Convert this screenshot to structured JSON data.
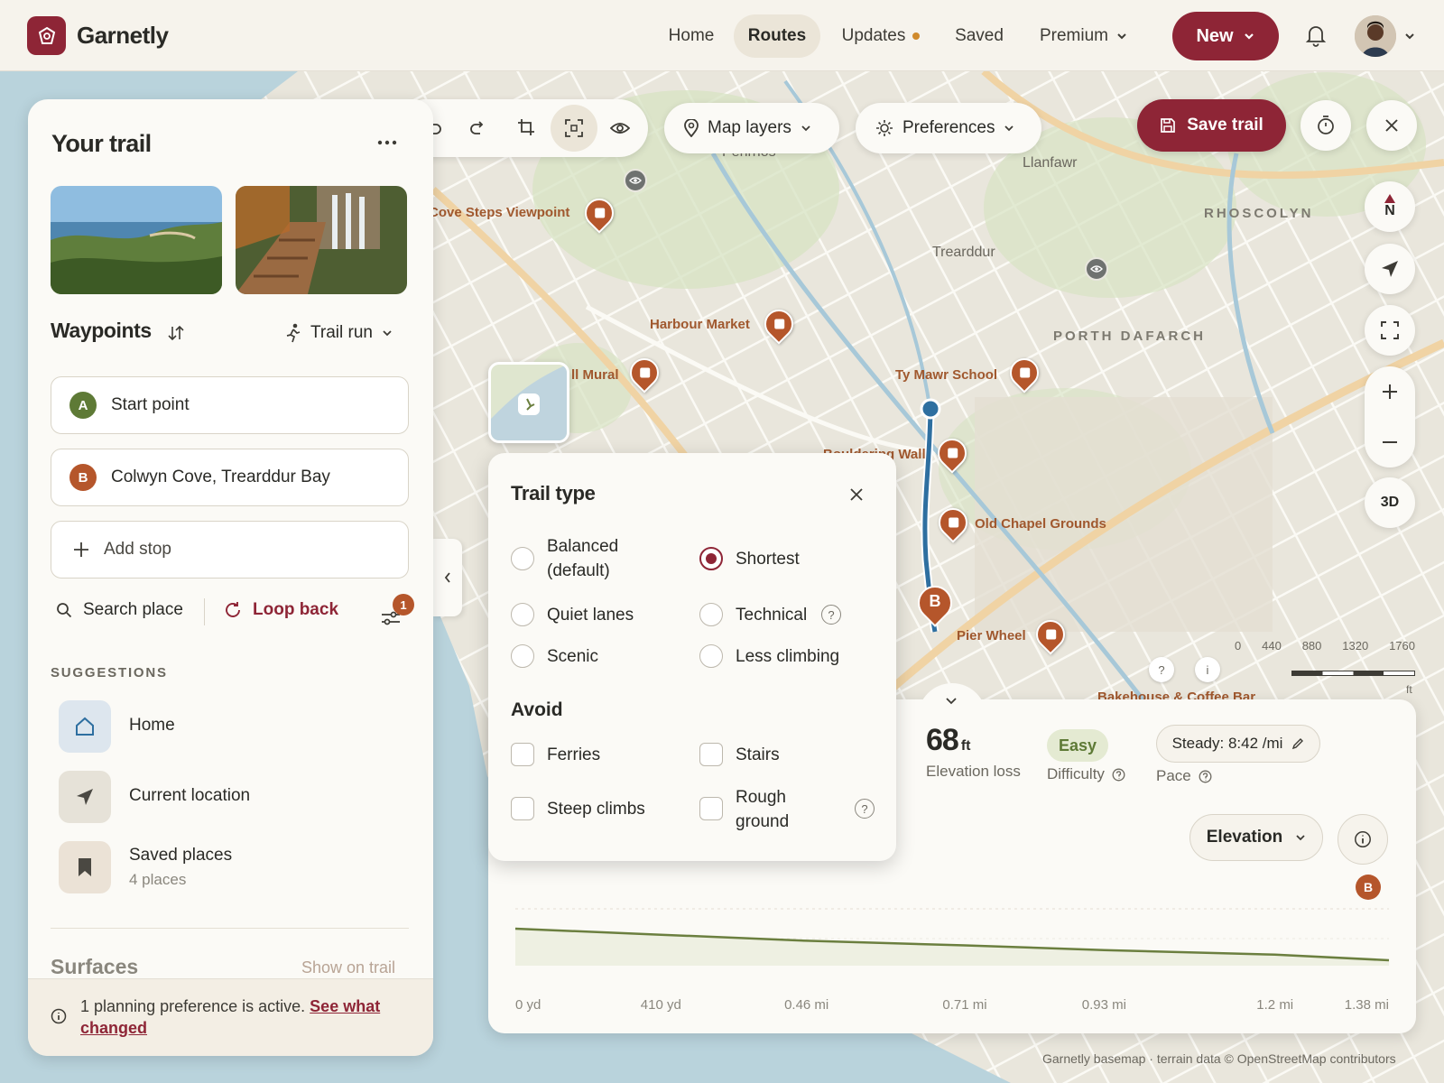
{
  "app": {
    "name": "Garnetly"
  },
  "nav": {
    "home": "Home",
    "routes": "Routes",
    "updates": "Updates",
    "saved": "Saved",
    "premium": "Premium",
    "new_label": "New"
  },
  "toolbar": {
    "map_layers": "Map layers",
    "preferences": "Preferences",
    "save_trail": "Save trail"
  },
  "map": {
    "labels": {
      "cove_steps": "Cove Steps Viewpoint",
      "harbour_market": "Harbour Market",
      "mural": "ll Mural",
      "ty_mawr": "Ty Mawr School",
      "old_chapel": "Old Chapel Grounds",
      "pier_wheel": "Pier Wheel",
      "bouldering": "Bouldering Wall",
      "bakehouse": "Bakehouse & Coffee Bar",
      "pentros": "Penrhos",
      "llanfawr": "Llanfawr",
      "trearddur": "Trearddur",
      "rhoscolyn": "RHOSCOLYN",
      "porth_dafarch": "PORTH DAFARCH"
    },
    "compass": "N",
    "three_d": "3D",
    "scale": {
      "ticks": [
        "0",
        "440",
        "880",
        "1320",
        "1760"
      ],
      "unit": "ft"
    },
    "pin_b": "B",
    "help_q": "?",
    "help_i": "i",
    "attribution": "Garnetly basemap · terrain data © OpenStreetMap contributors"
  },
  "panel": {
    "title": "Your trail",
    "waypoints_heading": "Waypoints",
    "mode": "Trail run",
    "start": {
      "badge": "A",
      "label": "Start point"
    },
    "end": {
      "badge": "B",
      "label": "Colwyn Cove, Trearddur Bay"
    },
    "add_stop": "Add stop",
    "search_place": "Search place",
    "loop_back": "Loop back",
    "filter_count": "1",
    "suggestions_heading": "SUGGESTIONS",
    "suggestions": [
      {
        "label": "Home",
        "sub": ""
      },
      {
        "label": "Current location",
        "sub": ""
      },
      {
        "label": "Saved places",
        "sub": "4 places"
      }
    ],
    "surfaces": "Surfaces",
    "show_on_trail": "Show on trail",
    "notice": "1 planning preference is active.",
    "notice_link": "See what changed"
  },
  "trail_type": {
    "title": "Trail type",
    "options": {
      "balanced": "Balanced (default)",
      "shortest": "Shortest",
      "quiet": "Quiet lanes",
      "technical": "Technical",
      "scenic": "Scenic",
      "less_climbing": "Less climbing"
    },
    "selected": "Shortest",
    "avoid_heading": "Avoid",
    "avoid": {
      "ferries": "Ferries",
      "stairs": "Stairs",
      "steep": "Steep climbs",
      "rough": "Rough ground"
    }
  },
  "stats": {
    "elev_loss_value": "68",
    "elev_loss_unit": "ft",
    "elev_loss_label": "Elevation loss",
    "difficulty_value": "Easy",
    "difficulty_label": "Difficulty",
    "pace_value": "Steady: 8:42 /mi",
    "pace_label": "Pace",
    "metric_select": "Elevation"
  },
  "chart_data": {
    "type": "area",
    "x_tick_labels": [
      "0 yd",
      "410 yd",
      "0.46 mi",
      "0.71 mi",
      "0.93 mi",
      "1.2 mi",
      "1.38 mi"
    ],
    "x": [
      0,
      0.23,
      0.46,
      0.71,
      0.93,
      1.2,
      1.38
    ],
    "values": [
      68,
      55,
      42,
      32,
      22,
      12,
      0
    ],
    "marker": "B",
    "xlabel": "",
    "ylabel": ""
  },
  "colors": {
    "brand": "#8e2536",
    "route": "#2e6fa0",
    "accent_pin": "#b5562b",
    "chart_line": "#6b7f3f"
  }
}
